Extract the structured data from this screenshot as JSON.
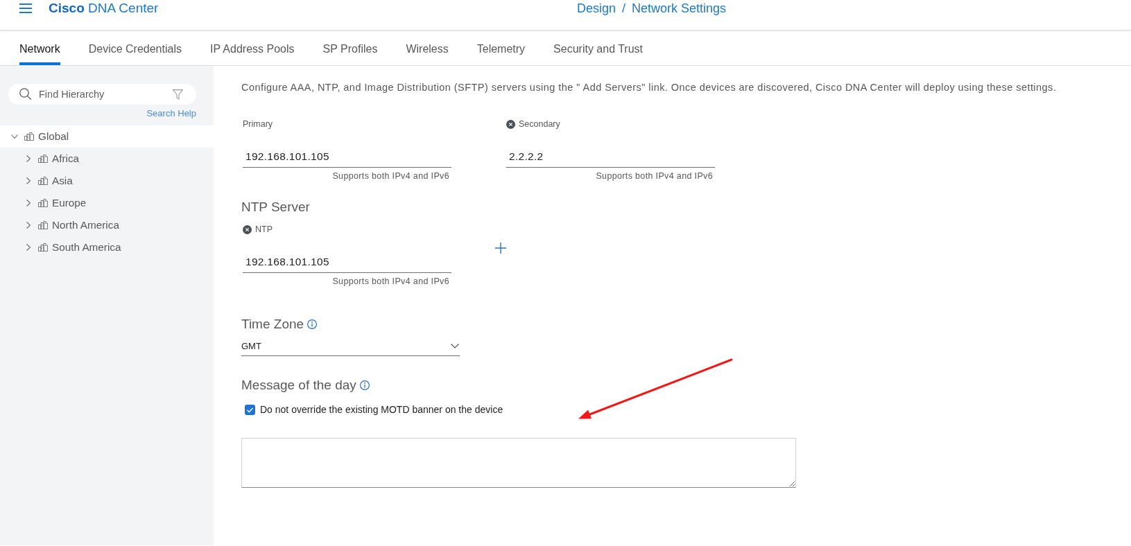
{
  "header": {
    "app_title": "**Cisco** DNA Center",
    "breadcrumb": [
      {
        "label": "Design"
      },
      {
        "label": "Network Settings"
      }
    ],
    "separator": "/"
  },
  "tabs": [
    {
      "label": "Network",
      "selected": true
    },
    {
      "label": "Device Credentials",
      "selected": false
    },
    {
      "label": "IP Address Pools",
      "selected": false
    },
    {
      "label": "SP Profiles",
      "selected": false
    },
    {
      "label": "Wireless",
      "selected": false
    },
    {
      "label": "Telemetry",
      "selected": false
    },
    {
      "label": "Security and Trust",
      "selected": false
    }
  ],
  "sidebar": {
    "search": {
      "placeholder": "Find Hierarchy"
    },
    "search_help": "Search Help",
    "tree": [
      {
        "label": "Global",
        "expanded": true,
        "selected": true,
        "children": [
          {
            "label": "Africa",
            "expanded": false,
            "selected": false
          },
          {
            "label": "Asia",
            "expanded": false,
            "selected": false
          },
          {
            "label": "Europe",
            "expanded": false,
            "selected": false
          },
          {
            "label": "North America",
            "expanded": false,
            "selected": false
          },
          {
            "label": "South America",
            "expanded": false,
            "selected": false
          }
        ]
      }
    ]
  },
  "main": {
    "description": "Configure AAA, NTP, and Image Distribution (SFTP) servers using the \" Add Servers\" link. Once devices are discovered, Cisco DNA Center will deploy using these settings.",
    "servers": [
      {
        "label": "Primary",
        "removable": false,
        "value": "192.168.101.105",
        "hint": "Supports both IPv4 and IPv6"
      },
      {
        "label": "Secondary",
        "removable": true,
        "value": "2.2.2.2",
        "hint": "Supports both IPv4 and IPv6"
      }
    ],
    "ntp": {
      "title": "NTP Server",
      "servers": [
        {
          "label": "NTP",
          "removable": true,
          "value": "192.168.101.105",
          "hint": "Supports both IPv4 and IPv6"
        }
      ]
    },
    "time_zone": {
      "title": "Time Zone",
      "value": "GMT"
    },
    "motd": {
      "title": "Message of the day",
      "checkbox": {
        "label": "Do not override the existing MOTD banner on the device",
        "checked": true
      }
    }
  }
}
